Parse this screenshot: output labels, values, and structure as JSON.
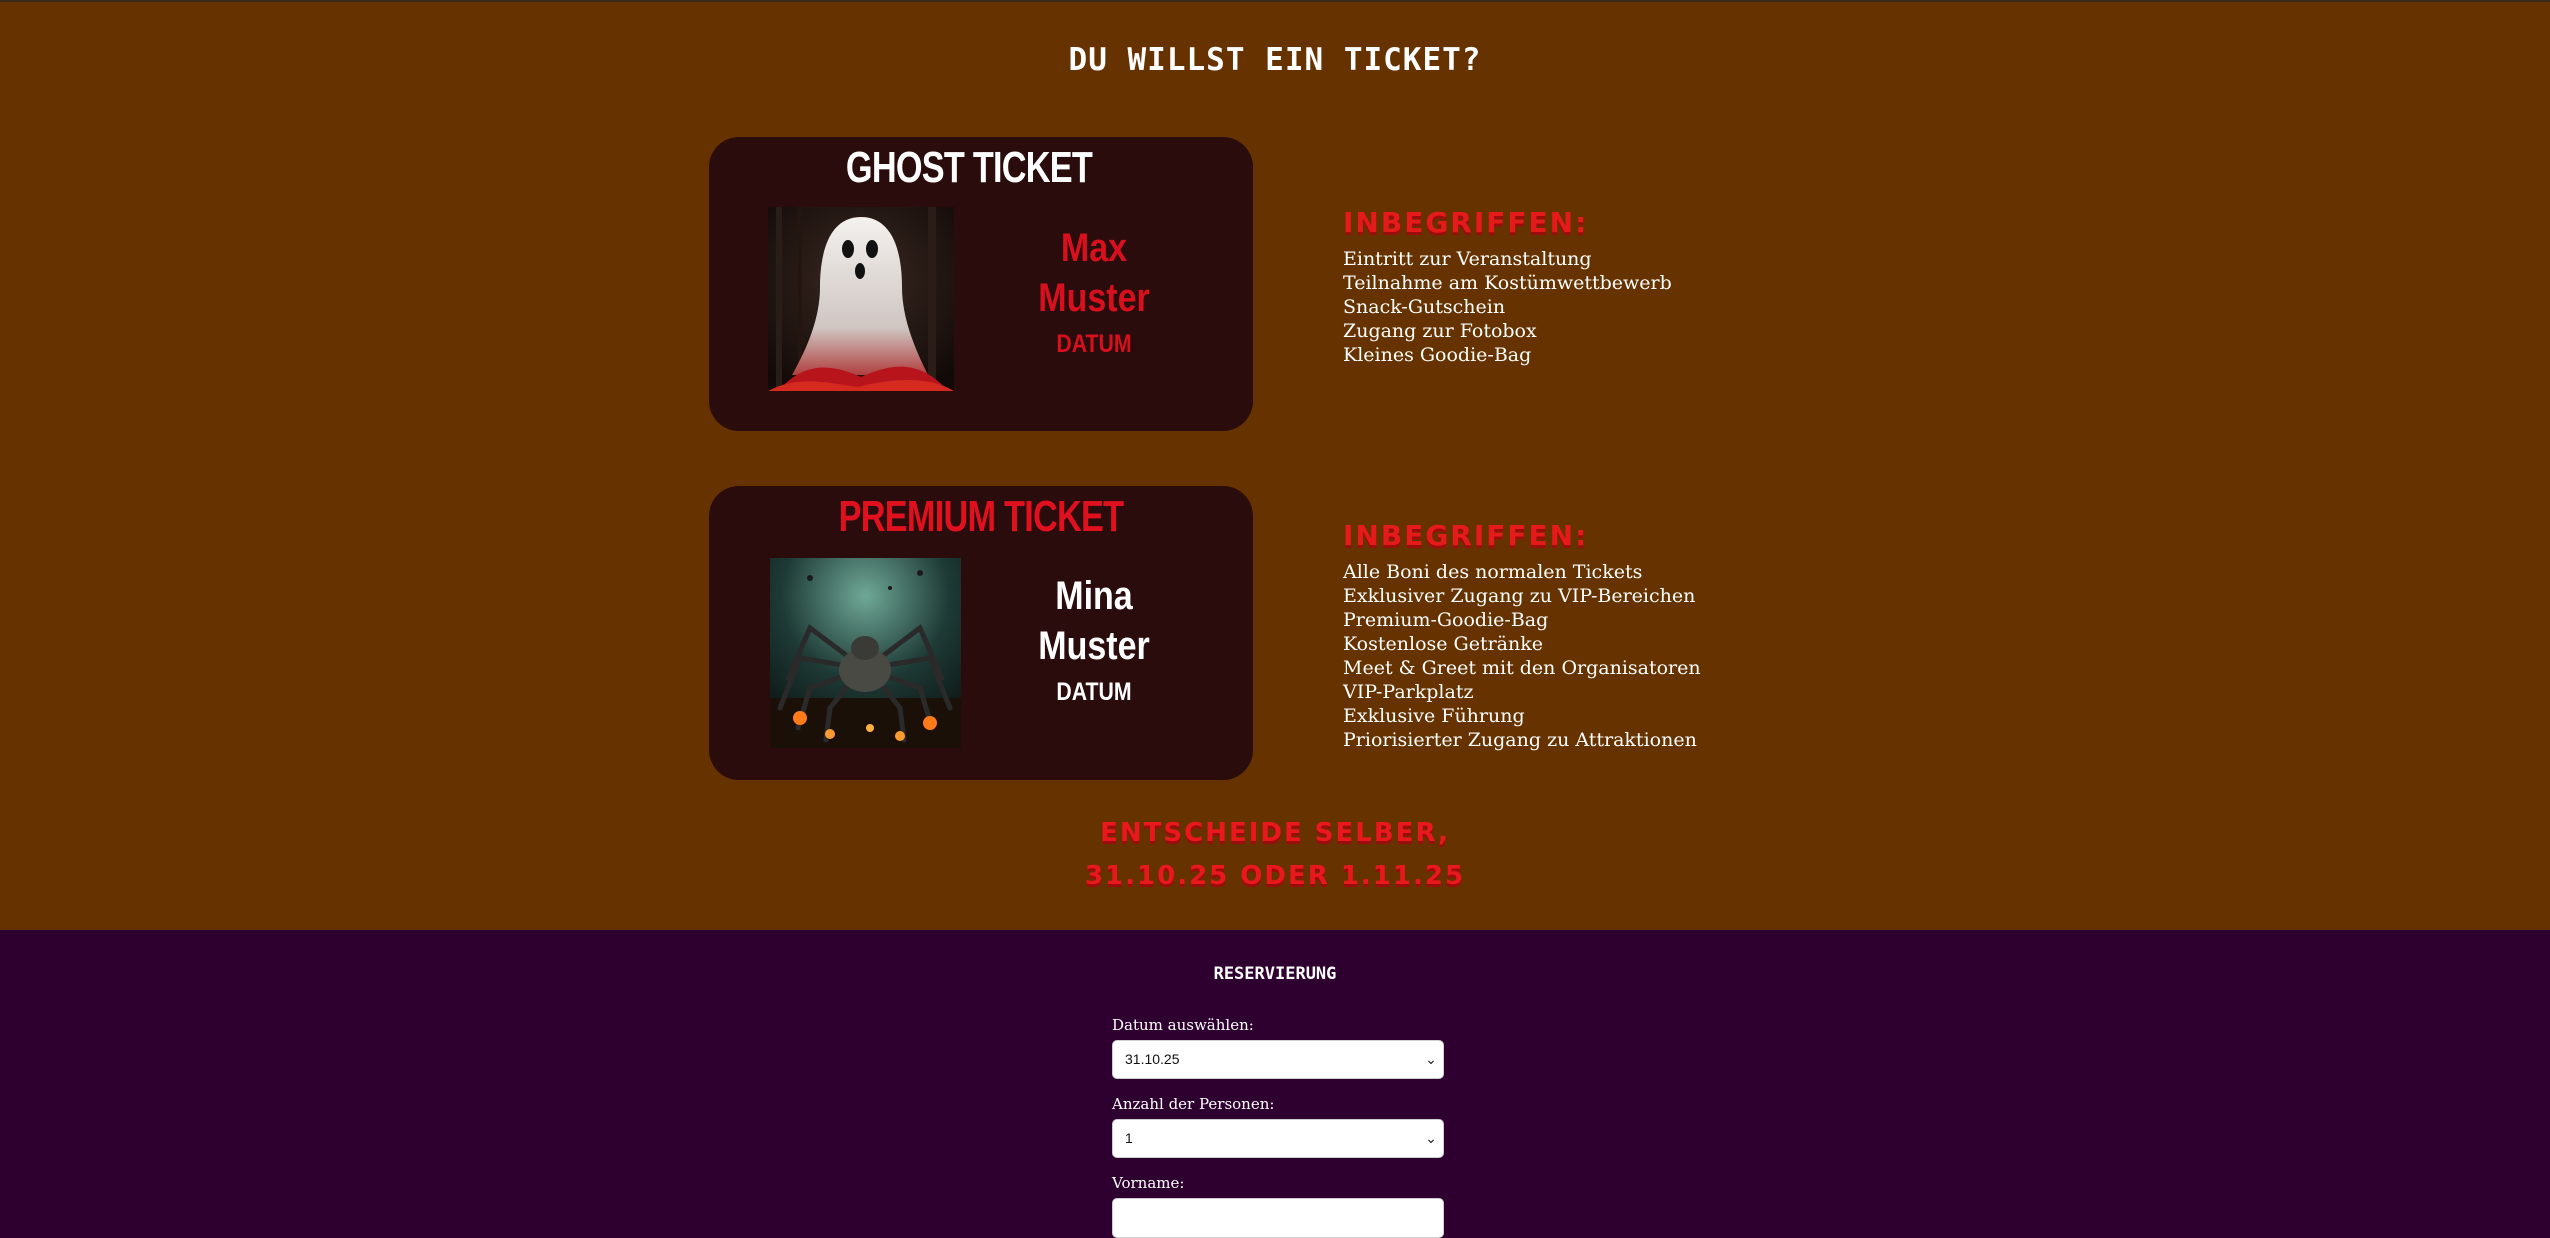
{
  "header": {
    "title": "DU WILLST EIN TICKET?"
  },
  "tickets": [
    {
      "name": "GHOST TICKET",
      "holder_first": "Max",
      "holder_last": "Muster",
      "date": "DATUM",
      "included_heading": "INBEGRIFFEN:",
      "included": [
        "Eintritt zur Veranstaltung",
        "Teilnahme am Kostümwettbewerb",
        "Snack-Gutschein",
        "Zugang zur Fotobox",
        "Kleines Goodie-Bag"
      ]
    },
    {
      "name": "PREMIUM TICKET",
      "holder_first": "Mina",
      "holder_last": "Muster",
      "date": "DATUM",
      "included_heading": "INBEGRIFFEN:",
      "included": [
        "Alle Boni des normalen Tickets",
        "Exklusiver Zugang zu VIP-Bereichen",
        "Premium-Goodie-Bag",
        "Kostenlose Getränke",
        "Meet & Greet mit den Organisatoren",
        "VIP-Parkplatz",
        "Exklusive Führung",
        "Priorisierter Zugang zu Attraktionen"
      ]
    }
  ],
  "decide": {
    "line1": "ENTSCHEIDE SELBER,",
    "line2": "31.10.25 ODER 1.11.25"
  },
  "reservation": {
    "title": "RESERVIERUNG",
    "date_label": "Datum auswählen:",
    "date_value": "31.10.25",
    "persons_label": "Anzahl der Personen:",
    "persons_value": "1",
    "firstname_label": "Vorname:",
    "firstname_value": ""
  },
  "colors": {
    "page_bg": "#663300",
    "ticket_bg": "#2a0c0c",
    "accent_red": "#e0101f",
    "reservation_bg": "#2e0030"
  },
  "icons": [
    "chevron-down-icon",
    "ghost-illustration",
    "spider-illustration"
  ]
}
